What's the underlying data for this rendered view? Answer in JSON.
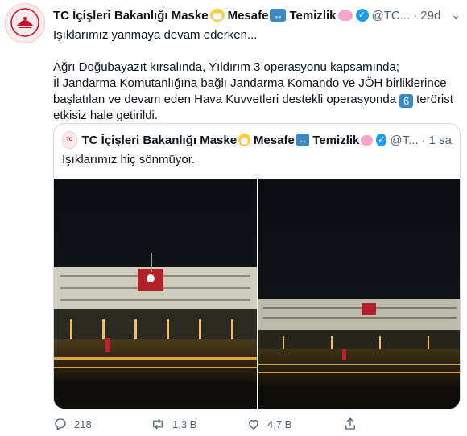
{
  "author": {
    "name": "TC İçişleri Bakanlığı Maske",
    "name_part2": "Mesafe",
    "name_part3": "Temizlik",
    "handle": "@TC...",
    "time": "29d",
    "avatar_text": "İÇİŞLERİ"
  },
  "tweet": {
    "line1": "Işıklarımız yanmaya devam ederken...",
    "para1": "Ağrı Doğubayazıt kırsalında, Yıldırım 3 operasyonu kapsamında;",
    "para2a": "İl Jandarma Komutanlığına bağlı Jandarma Komando ve JÖH birliklerince başlatılan ve devam eden Hava Kuvvetleri destekli operasyonda",
    "count_badge": "6",
    "para2b": "terörist etkisiz hale getirildi."
  },
  "quoted": {
    "name": "TC İçişleri Bakanlığı Maske",
    "name_part2": "Mesafe",
    "name_part3": "Temizlik",
    "handle": "@T...",
    "time": "1 sa",
    "text": "Işıklarımız hiç sönmüyor.",
    "avatar_text": "TC"
  },
  "actions": {
    "reply_count": "218",
    "retweet_count": "1,3 B",
    "like_count": "4,7 B"
  },
  "colors": {
    "accent": "#1d9bf0",
    "muted": "#536471",
    "border": "#cfd9de"
  }
}
